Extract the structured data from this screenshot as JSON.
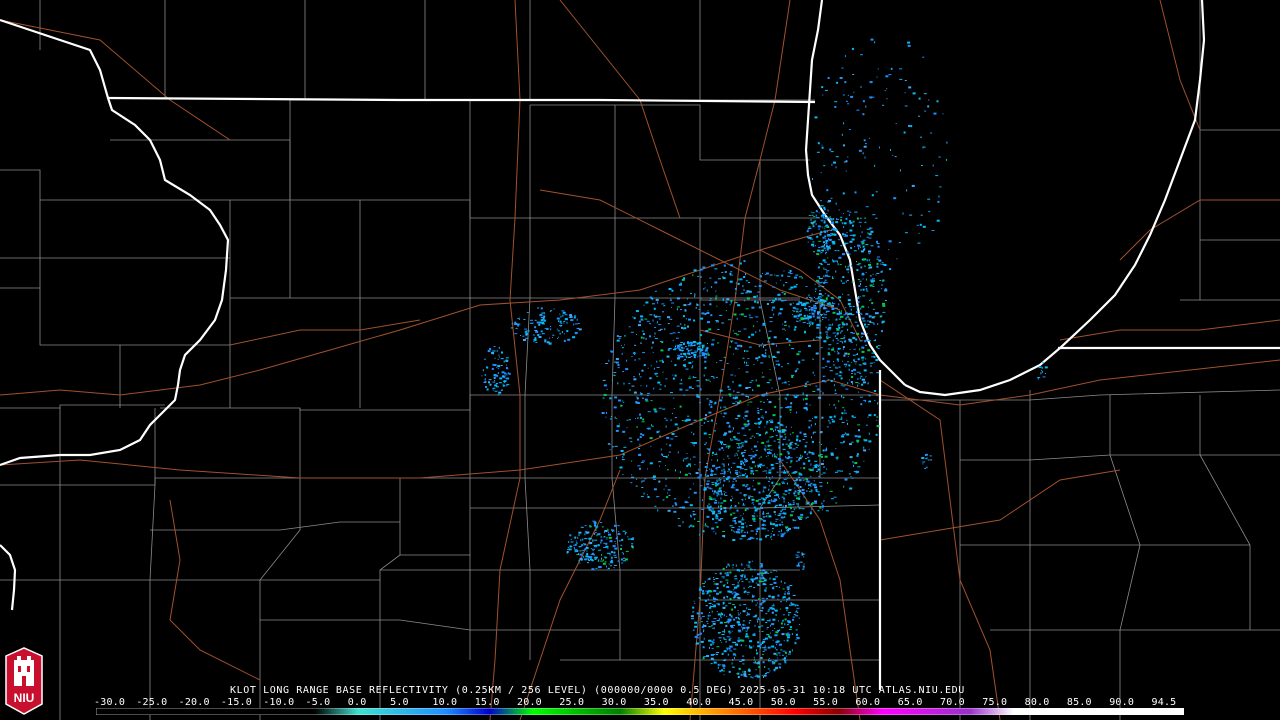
{
  "product_label": "KLOT LONG RANGE BASE REFLECTIVITY (0.25KM / 256 LEVEL) (000000/0000 0.5 DEG) 2025-05-31 10:18 UTC  ATLAS.NIU.EDU",
  "logo_text": "NIU",
  "scale_values": [
    "-30.0",
    "-25.0",
    "-20.0",
    "-15.0",
    "-10.0",
    "-5.0",
    "0.0",
    "5.0",
    "10.0",
    "15.0",
    "20.0",
    "25.0",
    "30.0",
    "35.0",
    "40.0",
    "45.0",
    "50.0",
    "55.0",
    "60.0",
    "65.0",
    "70.0",
    "75.0",
    "80.0",
    "85.0",
    "90.0",
    "94.5"
  ],
  "colors": {
    "background": "#000000",
    "state_border": "#ffffff",
    "county_border": "#8c8c8c",
    "highway": "#a0522d",
    "echo_light": "#1e90ff",
    "echo_mid": "#00bfff",
    "echo_strong": "#00c850",
    "logo_red": "#c8102e"
  },
  "colorbar_stops": [
    {
      "value": -30.0,
      "color": "#000000"
    },
    {
      "value": -5.0,
      "color": "#000000"
    },
    {
      "value": 0.0,
      "color": "#40e0d0"
    },
    {
      "value": 10.0,
      "color": "#1e90ff"
    },
    {
      "value": 15.0,
      "color": "#0000cd"
    },
    {
      "value": 20.0,
      "color": "#00ff00"
    },
    {
      "value": 30.0,
      "color": "#008000"
    },
    {
      "value": 35.0,
      "color": "#ffff00"
    },
    {
      "value": 40.0,
      "color": "#ffa500"
    },
    {
      "value": 50.0,
      "color": "#ff0000"
    },
    {
      "value": 55.0,
      "color": "#8b0000"
    },
    {
      "value": 60.0,
      "color": "#ff00ff"
    },
    {
      "value": 70.0,
      "color": "#9932cc"
    },
    {
      "value": 75.0,
      "color": "#ffffff"
    },
    {
      "value": 94.5,
      "color": "#ffffff"
    }
  ]
}
